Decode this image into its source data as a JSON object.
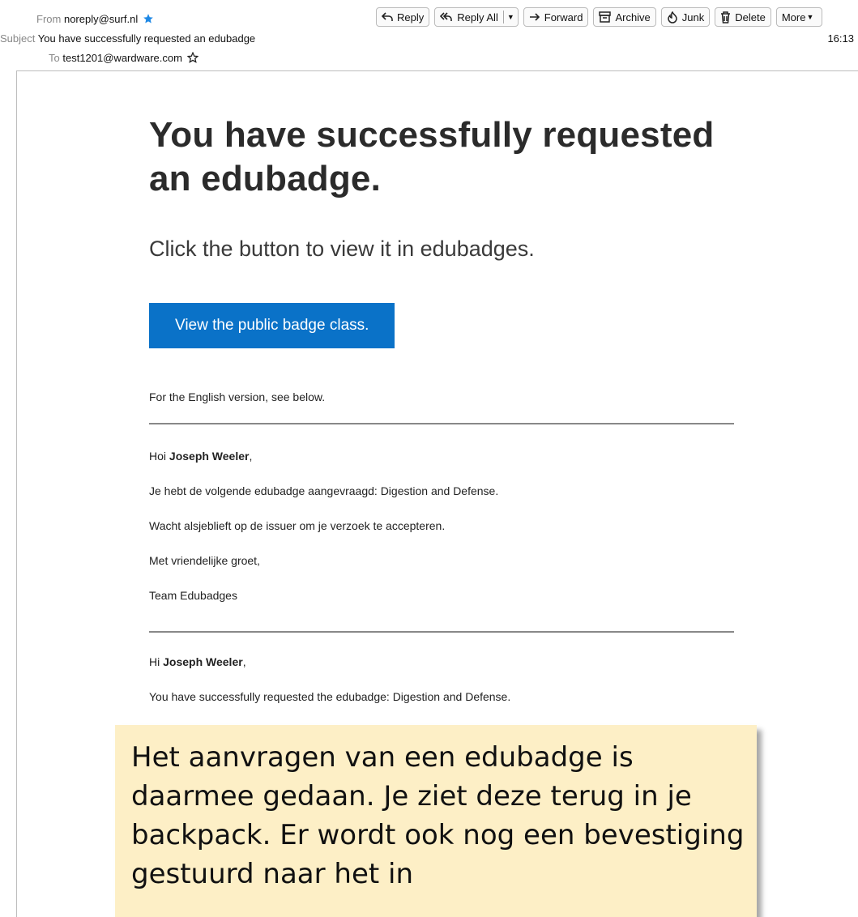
{
  "header": {
    "from_label": "From",
    "from_value": "noreply@surf.nl",
    "subject_label": "Subject",
    "subject_value": "You have successfully requested an edubadge",
    "to_label": "To",
    "to_value": "test1201@wardware.com",
    "time": "16:13"
  },
  "toolbar": {
    "reply": "Reply",
    "reply_all": "Reply All",
    "forward": "Forward",
    "archive": "Archive",
    "junk": "Junk",
    "delete": "Delete",
    "more": "More"
  },
  "email": {
    "title": "You have successfully requested an edubadge.",
    "subtitle": "Click the button to view it in edubadges.",
    "cta": "View the public badge class.",
    "english_note": "For the English version, see below.",
    "nl_greeting_prefix": "Hoi ",
    "nl_name": "Joseph Weeler",
    "nl_greeting_suffix": ",",
    "nl_line1": "Je hebt de volgende edubadge aangevraagd: Digestion and Defense.",
    "nl_line2": "Wacht alsjeblieft op de issuer om je verzoek te accepteren.",
    "nl_line3": "Met vriendelijke groet,",
    "nl_line4": "Team Edubadges",
    "en_greeting_prefix": "Hi ",
    "en_name": "Joseph Weeler",
    "en_greeting_suffix": ",",
    "en_line1": "You have successfully requested the edubadge: Digestion and Defense."
  },
  "note": {
    "text": "Het aanvragen van een edubadge is daarmee gedaan. Je ziet deze terug in je backpack. Er wordt ook nog een bevestiging gestuurd naar het in"
  },
  "colors": {
    "cta_bg": "#0a72c8",
    "note_bg": "#fdefc6",
    "star_blue": "#1e88e5"
  }
}
